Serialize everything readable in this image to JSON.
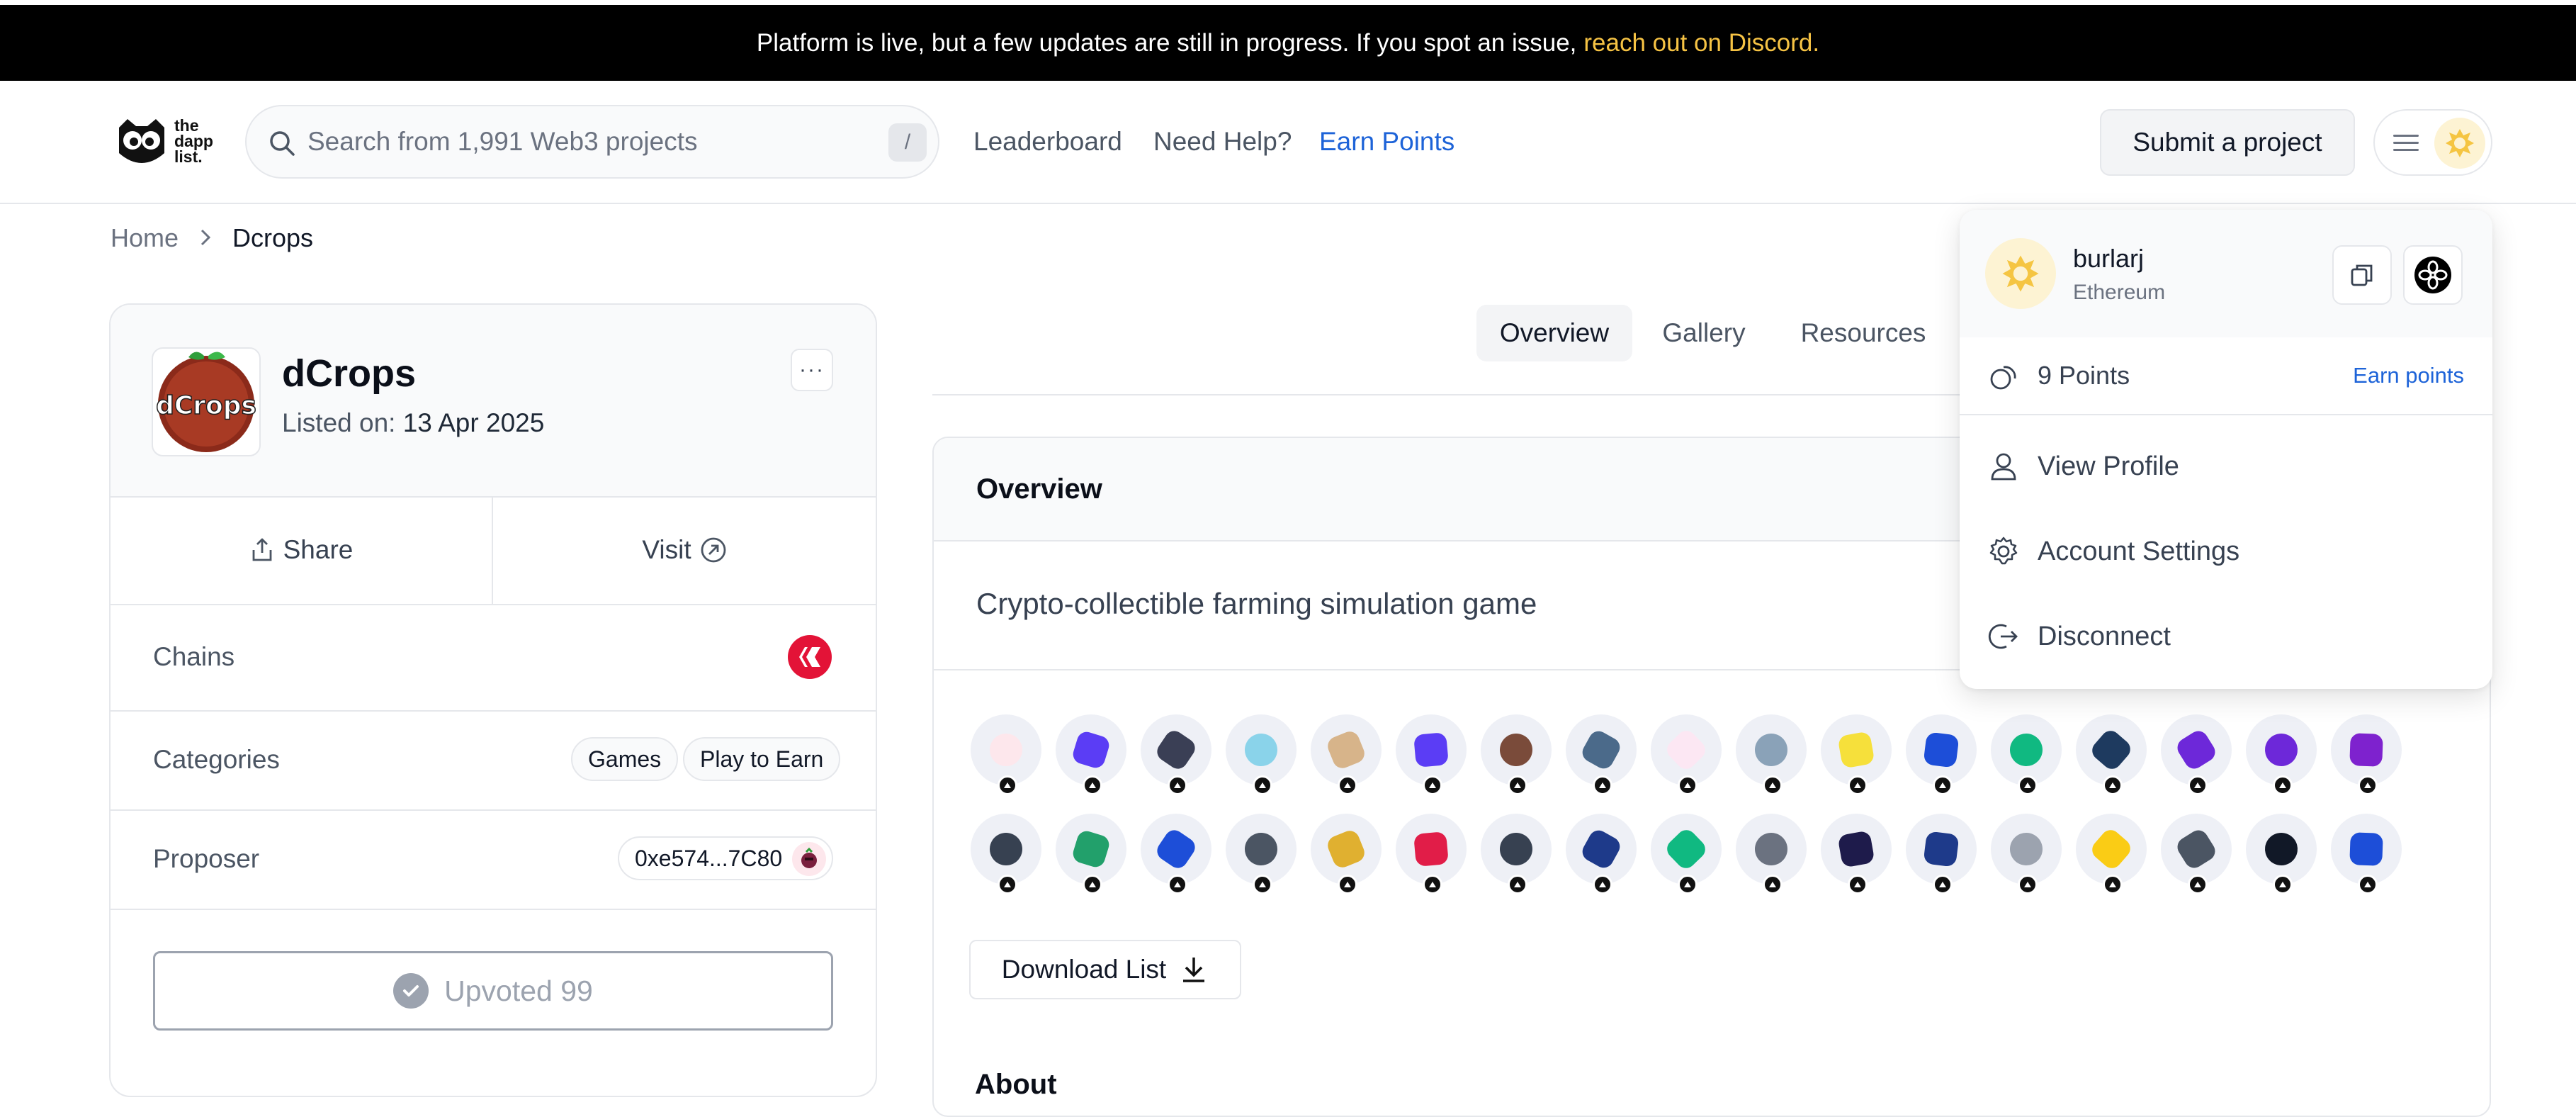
{
  "announcement": {
    "text": "Platform is live, but a few updates are still in progress. If you spot an issue,",
    "link": "reach out on Discord."
  },
  "header": {
    "logo_lines": [
      "the",
      "dapp",
      "list."
    ],
    "search_placeholder": "Search from 1,991 Web3 projects",
    "search_shortcut": "/",
    "nav": [
      "Leaderboard",
      "Need Help?",
      "Earn Points"
    ],
    "submit_label": "Submit a project"
  },
  "breadcrumb": {
    "home": "Home",
    "current": "Dcrops"
  },
  "project": {
    "logo_text": "dCrops",
    "name": "dCrops",
    "listed_label": "Listed on:",
    "listed_date": "13 Apr 2025",
    "more": "···",
    "share_label": "Share",
    "visit_label": "Visit",
    "chains_label": "Chains",
    "categories_label": "Categories",
    "categories": [
      "Games",
      "Play to Earn"
    ],
    "proposer_label": "Proposer",
    "proposer": "0xe574...7C80",
    "upvote_label": "Upvoted 99"
  },
  "tabs": [
    "Overview",
    "Gallery",
    "Resources"
  ],
  "overview": {
    "title": "Overview",
    "description": "Crypto-collectible farming simulation game",
    "download_label": "Download List",
    "about_title": "About"
  },
  "voter_colors": [
    [
      "#fde7ec",
      "#5b3df5",
      "#3a3f55",
      "#8ad3ea",
      "#d7b48a",
      "#5b3df5",
      "#7a4b3a",
      "#4b6a8a",
      "#fce7f3",
      "#8aa2b8",
      "#f6e03b",
      "#1d4ed8",
      "#10b981",
      "#1e3a5f",
      "#6d28d9",
      "#6d28d9",
      "#7e22ce"
    ],
    [
      "#374151",
      "#22a06b",
      "#1d4ed8",
      "#4b5563",
      "#e0b030",
      "#e11d48",
      "#374151",
      "#1e3a8a",
      "#10b981",
      "#6b7280",
      "#1e1b4b",
      "#1e3a8a",
      "#9ca3af",
      "#facc15",
      "#4b5563",
      "#111827",
      "#1d4ed8"
    ]
  ],
  "dropdown": {
    "username": "burlarj",
    "chain": "Ethereum",
    "points": "9 Points",
    "earn": "Earn points",
    "items": [
      "View Profile",
      "Account Settings",
      "Disconnect"
    ]
  },
  "colors": {
    "accent_link": "#1d63d8",
    "announcement_link": "#f6c344",
    "hive_red": "#e31337"
  }
}
